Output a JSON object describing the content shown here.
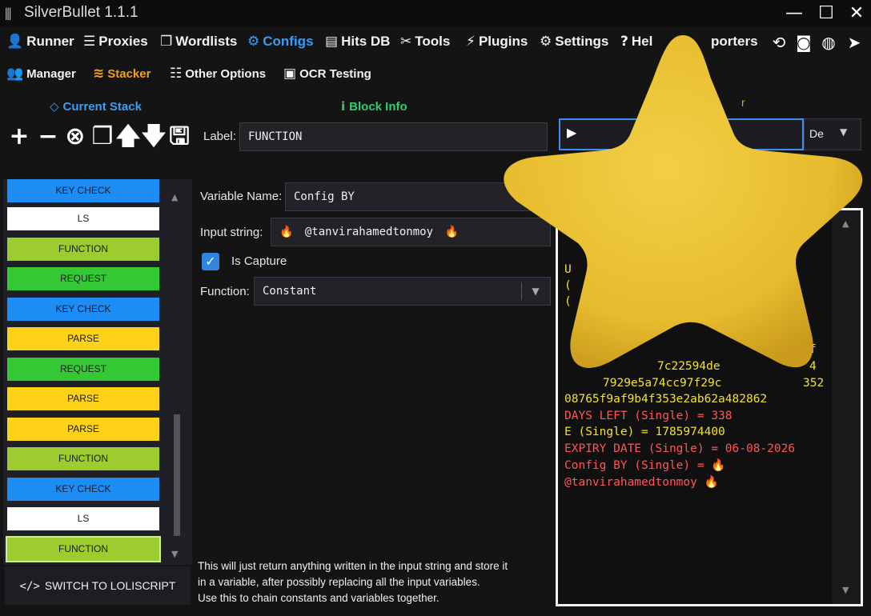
{
  "window": {
    "title": "SilverBullet 1.1.1"
  },
  "nav": [
    {
      "label": "Runner",
      "icon": "runner-icon"
    },
    {
      "label": "Proxies",
      "icon": "proxies-icon"
    },
    {
      "label": "Wordlists",
      "icon": "wordlists-icon"
    },
    {
      "label": "Configs",
      "icon": "gear-icon"
    },
    {
      "label": "Hits DB",
      "icon": "database-icon"
    },
    {
      "label": "Tools",
      "icon": "tools-icon"
    },
    {
      "label": "Plugins",
      "icon": "plug-icon"
    },
    {
      "label": "Settings",
      "icon": "gear-icon"
    },
    {
      "label": "Hel",
      "icon": "help-icon"
    },
    {
      "label": "porters",
      "icon": ""
    }
  ],
  "subnav": [
    {
      "label": "Manager",
      "icon": "users-icon"
    },
    {
      "label": "Stacker",
      "icon": "layers-icon"
    },
    {
      "label": "Other Options",
      "icon": "sliders-icon"
    },
    {
      "label": "OCR Testing",
      "icon": "ocr-icon"
    }
  ],
  "sections": {
    "current_stack": "Current Stack",
    "block_info": "Block Info"
  },
  "block_info": {
    "label_label": "Label:",
    "label_value": "FUNCTION",
    "variable_name_label": "Variable Name:",
    "variable_name_value": "Config BY",
    "input_string_label": "Input string:",
    "input_string_value": "@tanvirahamedtonmoy",
    "flame_glyph": "🔥",
    "capture_label": "Is Capture",
    "capture_checked": true,
    "function_label": "Function:",
    "function_value": "Constant",
    "description": [
      "This will just return anything written in the input string and store it",
      "in a variable, after possibly replacing all the input variables.",
      "Use this to chain constants and variables together."
    ]
  },
  "blocks": [
    {
      "label": "KEY CHECK",
      "color": "#1e8cf5"
    },
    {
      "label": "LS",
      "color": "#ffffff"
    },
    {
      "label": "FUNCTION",
      "color": "#9ccc2e"
    },
    {
      "label": "REQUEST",
      "color": "#34c934"
    },
    {
      "label": "KEY CHECK",
      "color": "#1e8cf5"
    },
    {
      "label": "PARSE",
      "color": "#ffd21a"
    },
    {
      "label": "REQUEST",
      "color": "#34c934"
    },
    {
      "label": "PARSE",
      "color": "#ffd21a"
    },
    {
      "label": "PARSE",
      "color": "#ffd21a"
    },
    {
      "label": "FUNCTION",
      "color": "#9ccc2e"
    },
    {
      "label": "KEY CHECK",
      "color": "#1e8cf5"
    },
    {
      "label": "LS",
      "color": "#ffffff"
    },
    {
      "label": "FUNCTION",
      "color": "#9ccc2e"
    }
  ],
  "switch_button": "SWITCH TO LOLISCRIPT",
  "debugger": {
    "dropdown_value": "De",
    "log_partial": [
      "U",
      "(",
      "(",
      "f",
      "7c22594de",
      "4",
      "7929e5a74cc97f29c",
      "352"
    ],
    "log_lines": [
      {
        "text": "08765f9af9b4f353e2ab62a482862",
        "color": "yellow"
      },
      {
        "text": "DAYS LEFT (Single) = 338",
        "color": "red"
      },
      {
        "text": "E (Single) = 1785974400",
        "color": "yellow"
      },
      {
        "text": "EXPIRY DATE (Single) = 06-08-2026",
        "color": "red"
      },
      {
        "text": "Config BY (Single) = 🔥",
        "color": "red"
      },
      {
        "text": "@tanvirahamedtonmoy 🔥",
        "color": "red"
      }
    ]
  },
  "colors": {
    "accent": "#3d9bf5",
    "active_sub": "#f0a020",
    "block_info_title": "#2ecc71",
    "log_yellow": "#f5e030",
    "log_red": "#ff5757"
  }
}
